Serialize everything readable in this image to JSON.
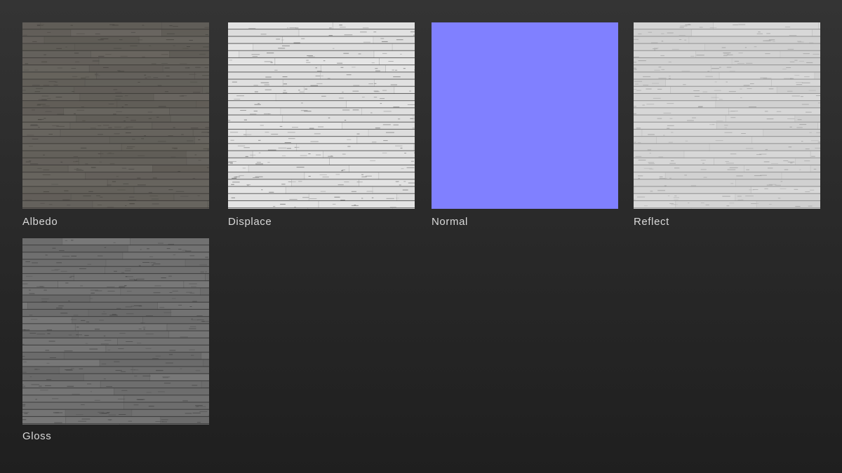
{
  "maps": [
    {
      "id": "albedo",
      "label": "Albedo",
      "base_color": "#6d6a64",
      "line_color": "#3e3c38",
      "grain_color": "#58554f",
      "style": "planks"
    },
    {
      "id": "displace",
      "label": "Displace",
      "base_color": "#e8e8e8",
      "line_color": "#5a5a5a",
      "grain_color": "#d6d6d6",
      "style": "planks"
    },
    {
      "id": "normal",
      "label": "Normal",
      "base_color": "#8080ff",
      "line_color": "#7b7bf8",
      "grain_color": "#8484ff",
      "style": "flat"
    },
    {
      "id": "reflect",
      "label": "Reflect",
      "base_color": "#dcdcdc",
      "line_color": "#8e8e8e",
      "grain_color": "#c8c8c8",
      "style": "planks"
    },
    {
      "id": "gloss",
      "label": "Gloss",
      "base_color": "#7d7d7d",
      "line_color": "#3c3c3c",
      "grain_color": "#5e5e5e",
      "style": "planks"
    }
  ]
}
